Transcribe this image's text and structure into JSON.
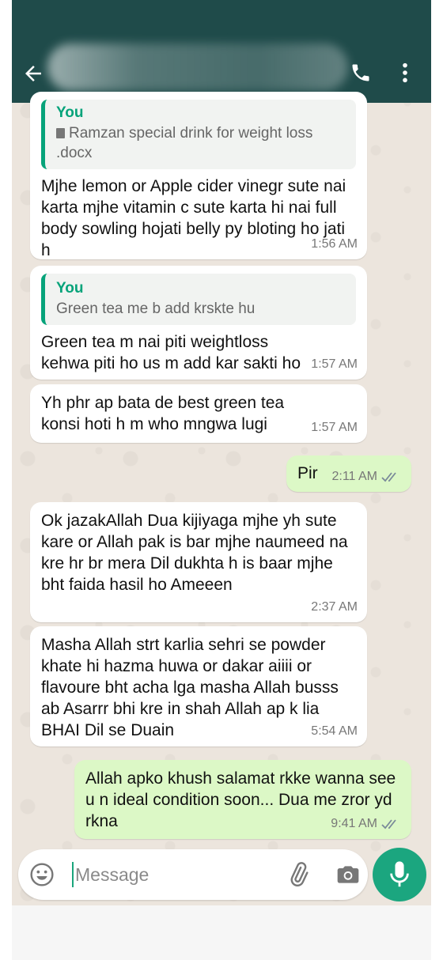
{
  "header": {
    "contact_name": "",
    "icons": [
      "back-arrow-icon",
      "phone-icon",
      "more-vert-icon"
    ],
    "color": "#1f4b4a"
  },
  "messages": [
    {
      "direction": "in",
      "quote_author": "You",
      "quote_text": "Ramzan special drink for weight loss .docx",
      "quote_icon": "document-icon",
      "text": "Mjhe lemon or Apple cider vinegr sute nai karta mjhe vitamin c sute karta hi nai full body sowling hojati belly py bloting ho jati h",
      "time": "1:56 AM"
    },
    {
      "direction": "in",
      "quote_author": "You",
      "quote_text": "Green tea me b add krskte hu",
      "text": "Green tea m nai piti weightloss kehwa piti ho us m add kar sakti ho",
      "time": "1:57 AM"
    },
    {
      "direction": "in",
      "text": "Yh phr ap bata de best green tea konsi hoti h m who mngwa lugi",
      "time": "1:57 AM"
    },
    {
      "direction": "out",
      "text": "Pir",
      "time": "2:11 AM",
      "status": "read"
    },
    {
      "direction": "in",
      "text": "Ok jazakAllah Dua kijiyaga mjhe yh sute kare or Allah pak is bar mjhe naumeed na kre hr br mera Dil dukhta h is baar mjhe bht faida hasil ho Ameeen",
      "time": "2:37 AM"
    },
    {
      "direction": "in",
      "text": "Masha Allah strt karlia sehri se powder khate hi hazma huwa or dakar aiiii or flavoure bht acha lga masha Allah busss ab Asarrr bhi kre in shah Allah ap k lia BHAI Dil se Duain",
      "time": "5:54 AM"
    },
    {
      "direction": "out",
      "text": "Allah apko khush salamat rkke wanna see u n ideal condition soon... Dua me zror yd rkna",
      "time": "9:41 AM",
      "status": "read"
    }
  ],
  "composer": {
    "placeholder": "Message",
    "icons": [
      "emoji-icon",
      "attach-icon",
      "camera-icon",
      "mic-icon"
    ],
    "accent": "#1ba67f"
  },
  "colors": {
    "wallpaper": "#ece5dd",
    "incoming": "#ffffff",
    "outgoing": "#dcf8c6",
    "quote_bar": "#06a37a",
    "read_ticks": "#7a8a99"
  }
}
